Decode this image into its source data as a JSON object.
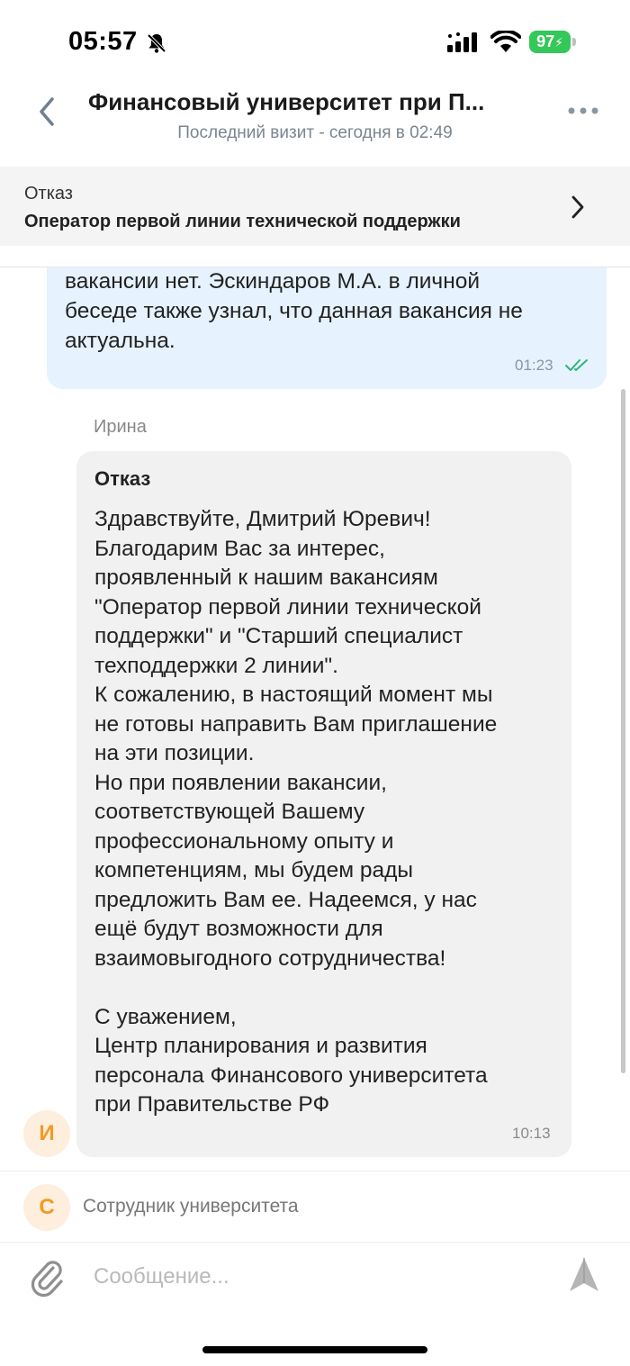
{
  "status_bar": {
    "time": "05:57",
    "battery": "97"
  },
  "header": {
    "title": "Финансовый университет при П...",
    "subtitle": "Последний визит - сегодня в 02:49"
  },
  "vacancy": {
    "status": "Отказ",
    "title": "Оператор первой линии технической поддержки"
  },
  "outgoing_message": {
    "text": "вакансии нет. Эскиндаров М.А. в личной\nбеседе также узнал, что данная вакансия не\nактуальна.",
    "time": "01:23"
  },
  "incoming_message": {
    "sender": "Ирина",
    "subject": "Отказ",
    "text": "Здравствуйте, Дмитрий Юревич!\nБлагодарим Вас за интерес,\nпроявленный к нашим вакансиям\n\"Оператор первой линии технической\nподдержки\" и \"Старший специалист\nтехподдержки 2 линии\".\nК сожалению, в настоящий момент мы\nне готовы направить Вам приглашение\nна эти позиции.\nНо при появлении вакансии,\nсоответствующей Вашему\nпрофессиональному опыту и\nкомпетенциям, мы будем рады\nпредложить Вам ее. Надеемся, у нас\nещё будут возможности для\nвзаимовыгодного сотрудничества!\n\nС уважением,\nЦентр планирования и развития\nперсонала Финансового университета\nпри Правительстве РФ",
    "time": "10:13",
    "avatar_letter": "И"
  },
  "role_row": {
    "avatar_letter": "С",
    "label": "Сотрудник университета"
  },
  "composer": {
    "placeholder": "Сообщение..."
  },
  "colors": {
    "accent": "#f39a23",
    "outgoing_bg": "#e6f2fd",
    "incoming_bg": "#f1f1f1",
    "battery": "#34c759",
    "check": "#2fb67a"
  }
}
